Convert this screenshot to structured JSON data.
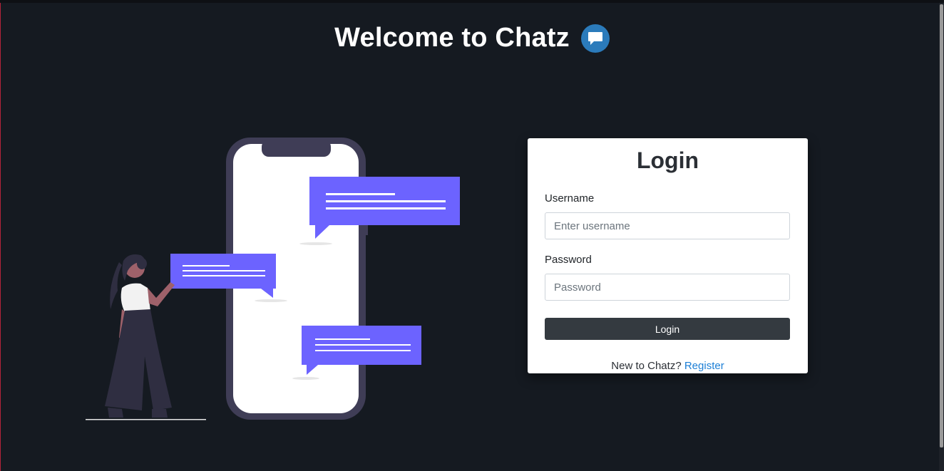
{
  "header": {
    "title": "Welcome to Chatz",
    "icon": "chat-bubble-icon",
    "icon_color": "#2b7bbb"
  },
  "login_card": {
    "title": "Login",
    "username": {
      "label": "Username",
      "placeholder": "Enter username",
      "value": ""
    },
    "password": {
      "label": "Password",
      "placeholder": "Password",
      "value": ""
    },
    "submit_label": "Login",
    "register_prompt": "New to Chatz?",
    "register_link": "Register"
  },
  "colors": {
    "background": "#151a21",
    "accent_bubble": "#6c63ff",
    "button": "#343a40",
    "link": "#1c7fd6"
  }
}
